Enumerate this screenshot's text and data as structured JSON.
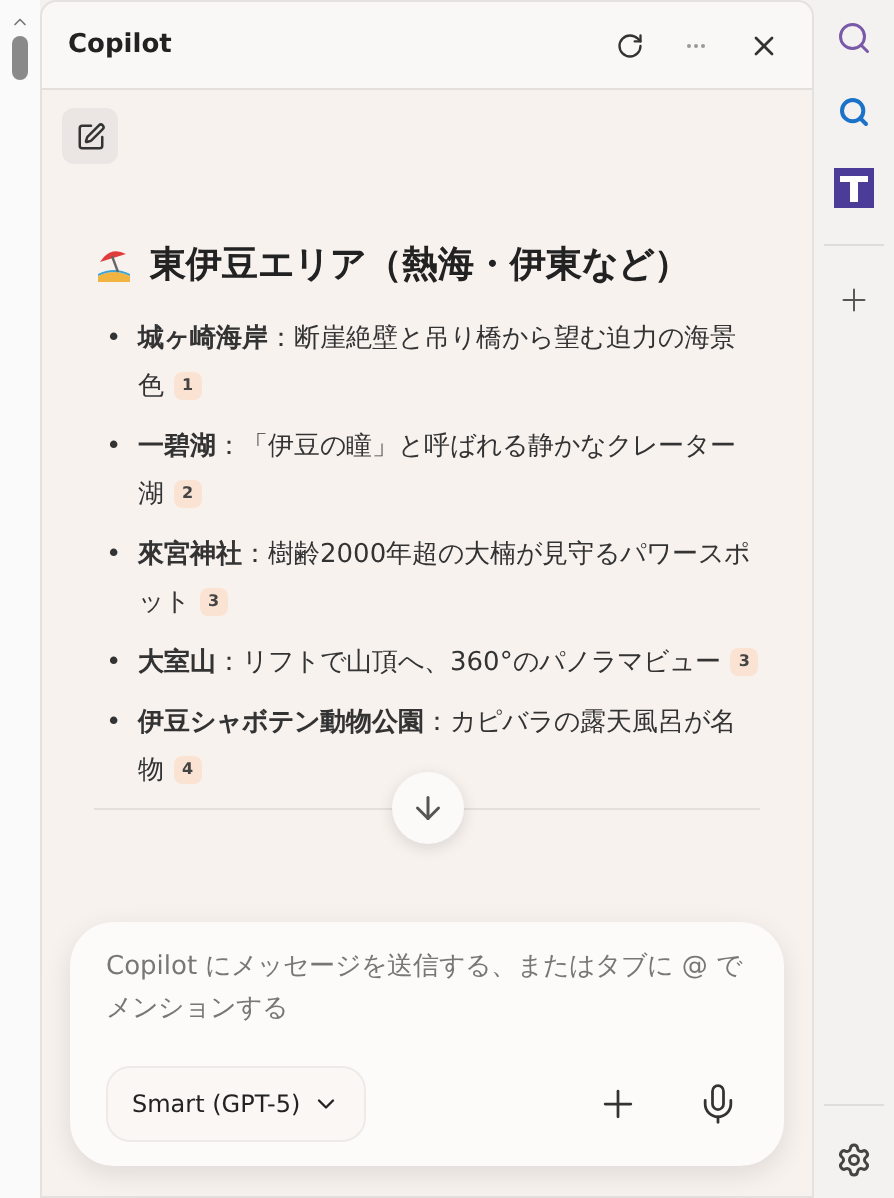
{
  "panel": {
    "title": "Copilot"
  },
  "heading": "東伊豆エリア（熱海・伊東など）",
  "items": [
    {
      "marker": "•",
      "term": "城ヶ崎海岸",
      "text": "：断崖絶壁と吊り橋から望む迫力の海景色",
      "cite": "1"
    },
    {
      "marker": "•",
      "term": "一碧湖",
      "text": "：「伊豆の瞳」と呼ばれる静かなクレーター湖",
      "cite": "2"
    },
    {
      "marker": "•",
      "term": "來宮神社",
      "text": "：樹齢2000年超の大楠が見守るパワースポット",
      "cite": "3"
    },
    {
      "marker": "•",
      "term": "大室山",
      "text": "：リフトで山頂へ、360°のパノラマビュー",
      "cite": "3"
    },
    {
      "marker": "•",
      "term": "伊豆シャボテン動物公園",
      "text": "：カピバラの露天風呂が名物",
      "cite": "4"
    }
  ],
  "composer": {
    "placeholder": "Copilot にメッセージを送信する、またはタブに @ でメンションする",
    "model": "Smart (GPT-5)"
  }
}
